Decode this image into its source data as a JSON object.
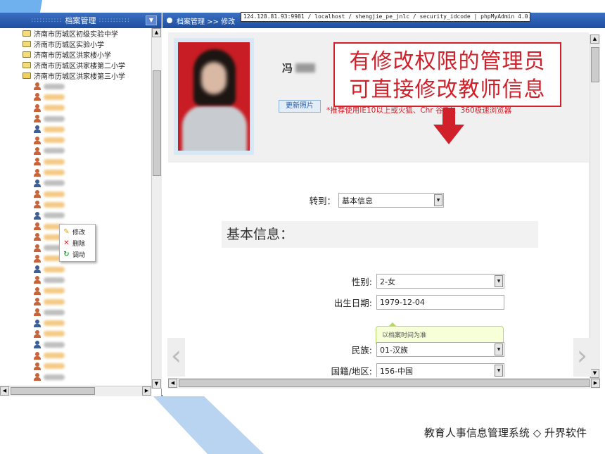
{
  "left_panel": {
    "title": "档案管理",
    "title_dots": ":::::::::::",
    "folders": [
      {
        "label": "济南市历城区初级实验中学",
        "open": false
      },
      {
        "label": "济南市历城区实验小学",
        "open": false
      },
      {
        "label": "济南市历城区洪家楼小学",
        "open": false
      },
      {
        "label": "济南市历城区洪家楼第二小学",
        "open": false
      },
      {
        "label": "济南市历城区洪家楼第三小学",
        "open": true
      }
    ]
  },
  "context_menu": {
    "items": [
      {
        "label": "修改",
        "icon": "edit-icon"
      },
      {
        "label": "删除",
        "icon": "delete-icon"
      },
      {
        "label": "调动",
        "icon": "transfer-icon"
      }
    ]
  },
  "breadcrumb": {
    "text": "档案管理 >> 修改"
  },
  "url_bar": {
    "text": "124.128.81.93:9981 / localhost / shengjie_pe_jnlc / security_idcode | phpMyAdmin 4.0.10deb1"
  },
  "profile": {
    "name": "冯",
    "upload_button": "更新照片",
    "browser_hint": "*推荐使用IE10以上或火狐、Chr   谷歌)、360极速浏览器"
  },
  "goto": {
    "label": "转到：",
    "selected": "基本信息"
  },
  "section": {
    "title": "基本信息："
  },
  "fields": {
    "gender": {
      "label": "性别:",
      "value": "2-女"
    },
    "birthdate": {
      "label": "出生日期:",
      "value": "1979-12-04"
    },
    "birthdate_tip": "以档案时间为准",
    "ethnicity": {
      "label": "民族:",
      "value": "01-汉族"
    },
    "nationality": {
      "label": "国籍/地区:",
      "value": "156-中国"
    }
  },
  "annotation": {
    "line1": "有修改权限的管理员",
    "line2": "可直接修改教师信息"
  },
  "footer": {
    "text": "教育人事信息管理系统 ◇ 升界软件"
  },
  "colors": {
    "header_blue": "#1e4e9e",
    "annotation_red": "#d0202a",
    "tip_green": "#f6ffd8"
  }
}
